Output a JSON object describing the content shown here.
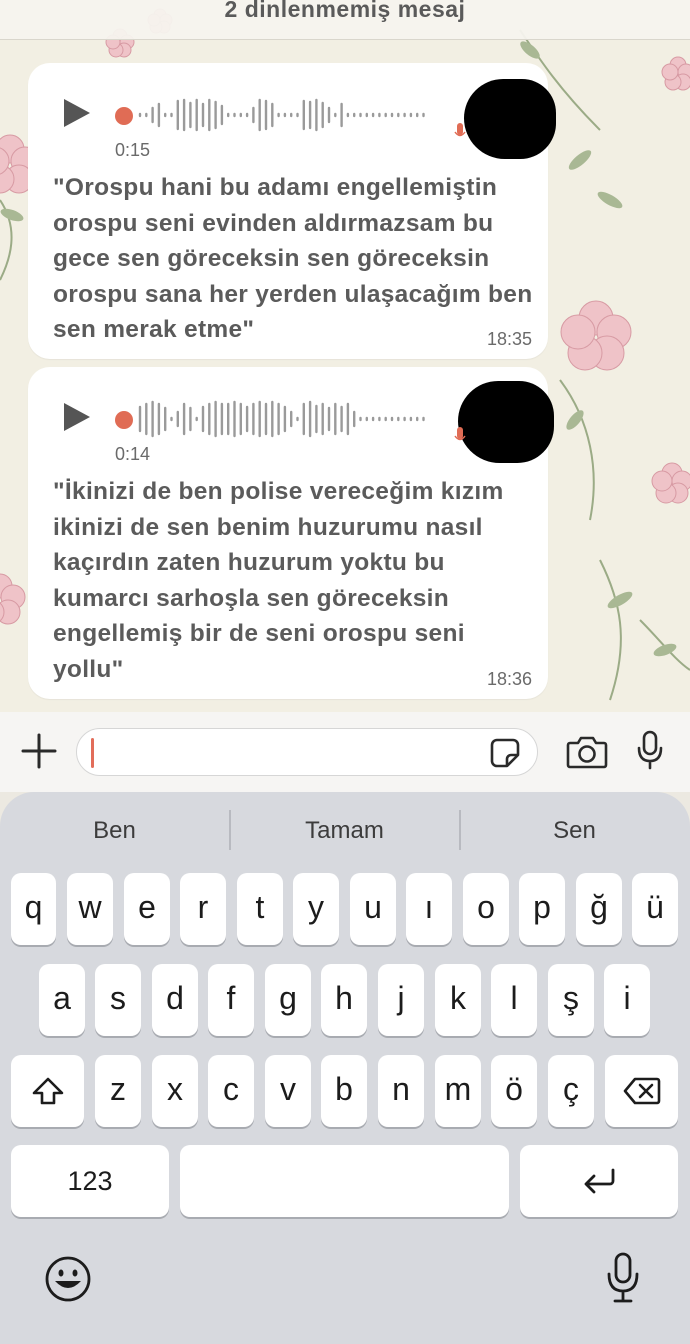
{
  "chat": {
    "unread_banner": "2 dinlenmemiş mesaj",
    "messages": [
      {
        "duration": "0:15",
        "transcript": "\"Orospu hani bu adamı engellemiştin orospu seni evinden aldırmazsam bu gece sen göreceksin sen göreceksin orospu sana her yerden ulaşacağım ben sen merak etme\"",
        "time": "18:35"
      },
      {
        "duration": "0:14",
        "transcript": "\"İkinizi de ben polise vereceğim kızım ikinizi de sen benim huzurumu nasıl kaçırdın zaten huzurum yoktu bu kumarcı sarhoşla sen göreceksin engellemiş bir de seni orospu seni yollu\"",
        "time": "18:36"
      }
    ]
  },
  "input": {
    "value": "",
    "placeholder": ""
  },
  "keyboard": {
    "suggestions": [
      "Ben",
      "Tamam",
      "Sen"
    ],
    "row1": [
      "q",
      "w",
      "e",
      "r",
      "t",
      "y",
      "u",
      "ı",
      "o",
      "p",
      "ğ",
      "ü"
    ],
    "row2": [
      "a",
      "s",
      "d",
      "f",
      "g",
      "h",
      "j",
      "k",
      "l",
      "ş",
      "i"
    ],
    "row3": [
      "z",
      "x",
      "c",
      "v",
      "b",
      "n",
      "m",
      "ö",
      "ç"
    ],
    "numbers_key": "123",
    "space_key": ""
  },
  "icons": {
    "add": "plus-icon",
    "sticker": "sticker-icon",
    "camera": "camera-icon",
    "voice": "microphone-icon",
    "shift": "shift-icon",
    "backspace": "backspace-icon",
    "return": "return-icon",
    "emoji": "emoji-icon",
    "dictation": "dictation-icon"
  },
  "colors": {
    "accent_dot": "#e06c55",
    "bubble": "#ffffff",
    "chat_bg": "#f2efe3",
    "keyboard_bg": "#d7d9de"
  }
}
